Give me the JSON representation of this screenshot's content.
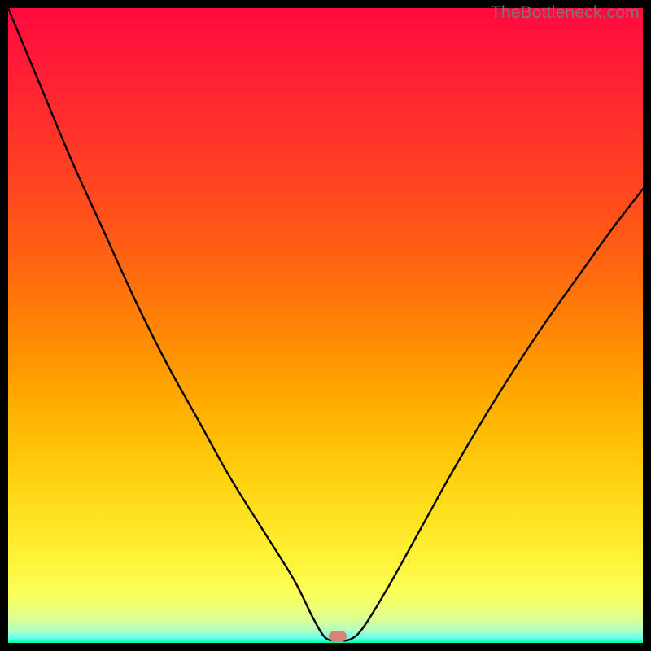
{
  "watermark": "TheBottleneck.com",
  "marker": {
    "x_pct": 51.9,
    "y_pct": 99.0,
    "color": "#d98478"
  },
  "chart_data": {
    "type": "line",
    "title": "",
    "xlabel": "",
    "ylabel": "",
    "xlim": [
      0,
      100
    ],
    "ylim": [
      0,
      100
    ],
    "series": [
      {
        "name": "bottleneck-curve",
        "x": [
          0.0,
          5.0,
          10.0,
          15.0,
          20.0,
          25.0,
          30.0,
          35.0,
          40.0,
          45.0,
          48.0,
          50.0,
          52.0,
          54.0,
          56.0,
          60.0,
          65.0,
          70.0,
          75.0,
          80.0,
          85.0,
          90.0,
          95.0,
          100.0
        ],
        "y": [
          100.0,
          88.0,
          76.0,
          65.0,
          54.0,
          44.0,
          35.0,
          26.0,
          18.0,
          10.0,
          4.0,
          0.8,
          0.4,
          0.6,
          2.5,
          9.0,
          18.0,
          27.0,
          35.5,
          43.5,
          51.0,
          58.0,
          65.0,
          71.5
        ]
      }
    ],
    "annotations": [
      {
        "type": "marker",
        "x": 51.9,
        "y": 0.6,
        "label": "optimal-point"
      }
    ]
  }
}
